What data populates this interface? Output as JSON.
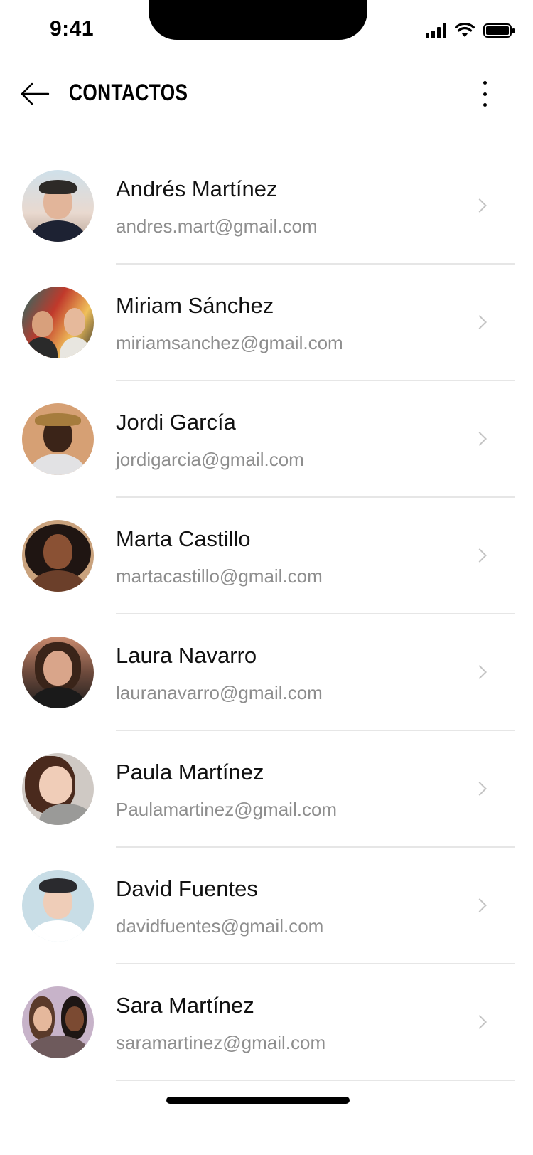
{
  "status_bar": {
    "time": "9:41"
  },
  "header": {
    "title": "CONTACTOS",
    "back_icon": "arrow-left-icon",
    "more_icon": "more-vertical-icon"
  },
  "contacts": [
    {
      "name": "Andrés Martínez",
      "email": "andres.mart@gmail.com"
    },
    {
      "name": "Miriam Sánchez",
      "email": "miriamsanchez@gmail.com"
    },
    {
      "name": "Jordi García",
      "email": "jordigarcia@gmail.com"
    },
    {
      "name": "Marta Castillo",
      "email": "martacastillo@gmail.com"
    },
    {
      "name": "Laura Navarro",
      "email": "lauranavarro@gmail.com"
    },
    {
      "name": "Paula Martínez",
      "email": "Paulamartinez@gmail.com"
    },
    {
      "name": "David Fuentes",
      "email": "davidfuentes@gmail.com"
    },
    {
      "name": "Sara Martínez",
      "email": "saramartinez@gmail.com"
    }
  ],
  "colors": {
    "email_text": "#8e8e8e",
    "divider": "#e6e6e6",
    "chevron": "#c4c4c4"
  }
}
